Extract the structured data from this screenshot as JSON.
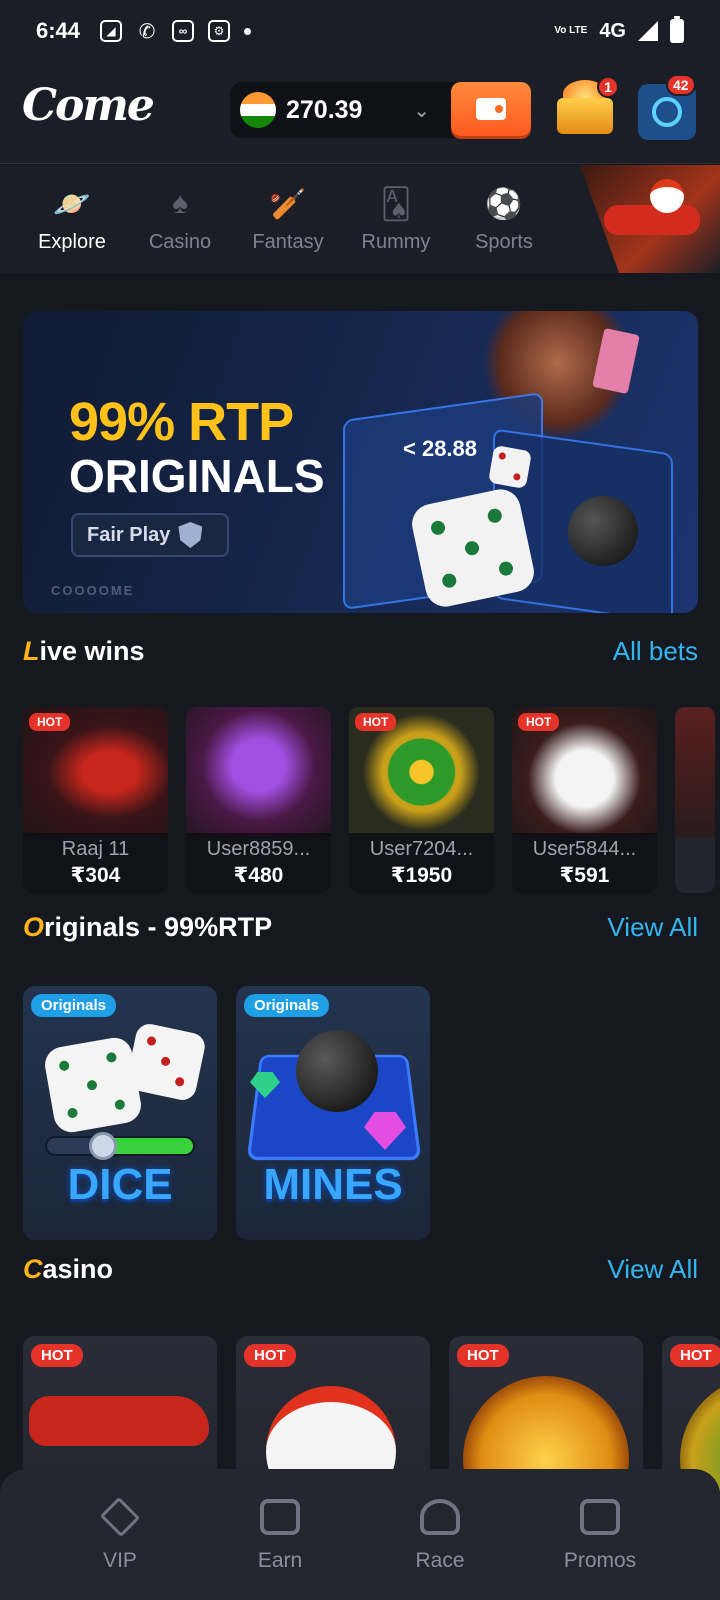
{
  "status_bar": {
    "time": "6:44",
    "network": "4G",
    "volte": "Vo LTE"
  },
  "header": {
    "logo": "Come",
    "balance": "270.39",
    "gift_badge": "1",
    "support_badge": "42"
  },
  "categories": [
    {
      "label": "Explore",
      "icon": "planet-icon",
      "active": true
    },
    {
      "label": "Casino",
      "icon": "spade-icon",
      "active": false
    },
    {
      "label": "Fantasy",
      "icon": "bat-icon",
      "active": false
    },
    {
      "label": "Rummy",
      "icon": "cards-icon",
      "active": false
    },
    {
      "label": "Sports",
      "icon": "ball-icon",
      "active": false
    }
  ],
  "banner": {
    "title_line1": "99% RTP",
    "title_line2": "ORIGINALS",
    "fair_play": "Fair Play",
    "brand": "COOOOME",
    "multiplier": "< 28.88"
  },
  "live_wins": {
    "title_first": "L",
    "title_rest": "ive wins",
    "link": "All bets",
    "items": [
      {
        "user": "Raaj 11",
        "amount": "₹304",
        "hot": "HOT",
        "game_art": "aviator-plane"
      },
      {
        "user": "User8859...",
        "amount": "₹480",
        "hot": "",
        "game_art": "1000x-dome"
      },
      {
        "user": "User7204...",
        "amount": "₹1950",
        "hot": "HOT",
        "game_art": "money-wheel"
      },
      {
        "user": "User5844...",
        "amount": "₹591",
        "hot": "HOT",
        "game_art": "chicken-road"
      }
    ]
  },
  "originals": {
    "title_first": "O",
    "title_rest": "riginals - 99%RTP",
    "link": "View All",
    "items": [
      {
        "badge": "Originals",
        "name": "DICE"
      },
      {
        "badge": "Originals",
        "name": "MINES"
      }
    ]
  },
  "casino": {
    "title_first": "C",
    "title_rest": "asino",
    "link": "View All",
    "items": [
      {
        "hot": "HOT",
        "art": "aviator"
      },
      {
        "hot": "HOT",
        "art": "chicken"
      },
      {
        "hot": "HOT",
        "art": "golden-wheel"
      },
      {
        "hot": "HOT",
        "art": "wheel"
      }
    ]
  },
  "bottom_nav": [
    {
      "label": "VIP",
      "icon": "diamond-icon"
    },
    {
      "label": "Earn",
      "icon": "rupee-card-icon"
    },
    {
      "label": "Race",
      "icon": "trophy-icon"
    },
    {
      "label": "Promos",
      "icon": "gift-icon"
    }
  ],
  "colors": {
    "accent_orange": "#ff6a25",
    "link_blue": "#33b5f0",
    "hot_red": "#e5332a",
    "gold": "#ffb31a"
  }
}
